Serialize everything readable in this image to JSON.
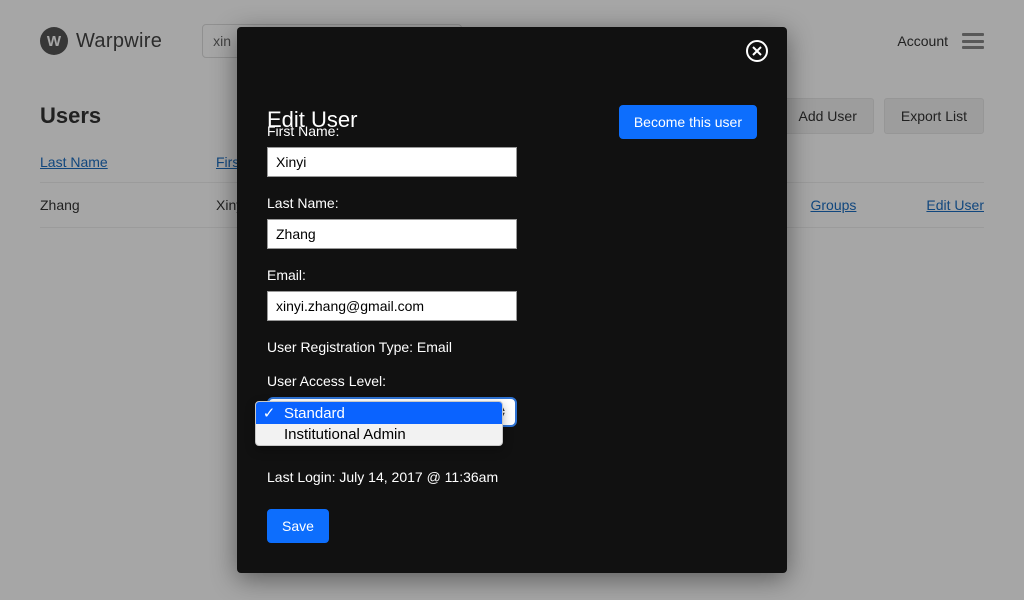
{
  "brand": {
    "mark": "W",
    "name": "Warpwire"
  },
  "search": {
    "value": "xin"
  },
  "topbar": {
    "account": "Account"
  },
  "users": {
    "title": "Users",
    "addUser": "Add User",
    "exportList": "Export List",
    "columns": {
      "last": "Last Name",
      "first": "First Name"
    },
    "row": {
      "last": "Zhang",
      "first": "Xinyi",
      "groups": "Groups",
      "edit": "Edit User"
    }
  },
  "modal": {
    "title": "Edit User",
    "become": "Become this user",
    "labels": {
      "first": "First Name:",
      "last": "Last Name:",
      "email": "Email:",
      "regType": "User Registration Type:",
      "access": "User Access Level:",
      "lastLogin": "Last Login:"
    },
    "values": {
      "first": "Xinyi",
      "last": "Zhang",
      "email": "xinyi.zhang@gmail.com",
      "regType": "Email",
      "lastLogin": "July 14, 2017 @ 11:36am"
    },
    "accessOptions": {
      "standard": "Standard",
      "admin": "Institutional Admin"
    },
    "save": "Save"
  }
}
